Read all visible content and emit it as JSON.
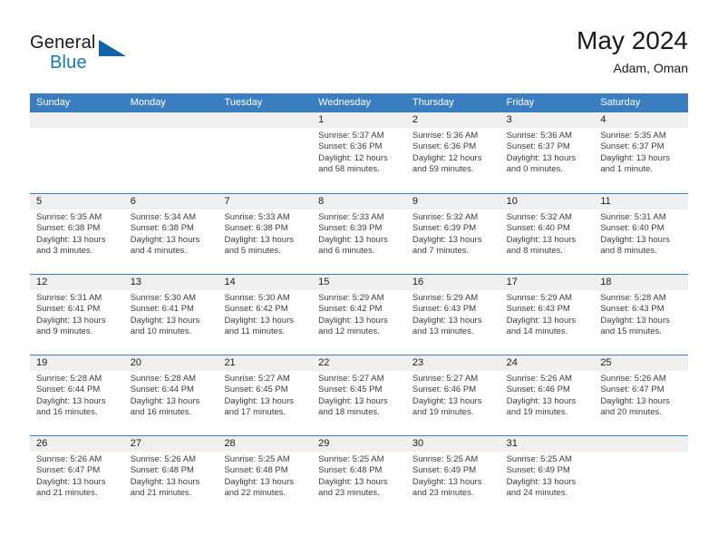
{
  "brand": {
    "word1": "General",
    "word2": "Blue",
    "triangle_color": "#1163a8",
    "blue_color": "#1675c0"
  },
  "header": {
    "month_title": "May 2024",
    "location": "Adam, Oman"
  },
  "theme": {
    "header_band": "#3a7ebf",
    "daynum_band": "#f0f0f0",
    "text": "#3c3c3c"
  },
  "calendar": {
    "day_headers": [
      "Sunday",
      "Monday",
      "Tuesday",
      "Wednesday",
      "Thursday",
      "Friday",
      "Saturday"
    ],
    "weeks": [
      [
        {
          "day": "",
          "lines": []
        },
        {
          "day": "",
          "lines": []
        },
        {
          "day": "",
          "lines": []
        },
        {
          "day": "1",
          "lines": [
            "Sunrise: 5:37 AM",
            "Sunset: 6:36 PM",
            "Daylight: 12 hours",
            "and 58 minutes."
          ]
        },
        {
          "day": "2",
          "lines": [
            "Sunrise: 5:36 AM",
            "Sunset: 6:36 PM",
            "Daylight: 12 hours",
            "and 59 minutes."
          ]
        },
        {
          "day": "3",
          "lines": [
            "Sunrise: 5:36 AM",
            "Sunset: 6:37 PM",
            "Daylight: 13 hours",
            "and 0 minutes."
          ]
        },
        {
          "day": "4",
          "lines": [
            "Sunrise: 5:35 AM",
            "Sunset: 6:37 PM",
            "Daylight: 13 hours",
            "and 1 minute."
          ]
        }
      ],
      [
        {
          "day": "5",
          "lines": [
            "Sunrise: 5:35 AM",
            "Sunset: 6:38 PM",
            "Daylight: 13 hours",
            "and 3 minutes."
          ]
        },
        {
          "day": "6",
          "lines": [
            "Sunrise: 5:34 AM",
            "Sunset: 6:38 PM",
            "Daylight: 13 hours",
            "and 4 minutes."
          ]
        },
        {
          "day": "7",
          "lines": [
            "Sunrise: 5:33 AM",
            "Sunset: 6:38 PM",
            "Daylight: 13 hours",
            "and 5 minutes."
          ]
        },
        {
          "day": "8",
          "lines": [
            "Sunrise: 5:33 AM",
            "Sunset: 6:39 PM",
            "Daylight: 13 hours",
            "and 6 minutes."
          ]
        },
        {
          "day": "9",
          "lines": [
            "Sunrise: 5:32 AM",
            "Sunset: 6:39 PM",
            "Daylight: 13 hours",
            "and 7 minutes."
          ]
        },
        {
          "day": "10",
          "lines": [
            "Sunrise: 5:32 AM",
            "Sunset: 6:40 PM",
            "Daylight: 13 hours",
            "and 8 minutes."
          ]
        },
        {
          "day": "11",
          "lines": [
            "Sunrise: 5:31 AM",
            "Sunset: 6:40 PM",
            "Daylight: 13 hours",
            "and 8 minutes."
          ]
        }
      ],
      [
        {
          "day": "12",
          "lines": [
            "Sunrise: 5:31 AM",
            "Sunset: 6:41 PM",
            "Daylight: 13 hours",
            "and 9 minutes."
          ]
        },
        {
          "day": "13",
          "lines": [
            "Sunrise: 5:30 AM",
            "Sunset: 6:41 PM",
            "Daylight: 13 hours",
            "and 10 minutes."
          ]
        },
        {
          "day": "14",
          "lines": [
            "Sunrise: 5:30 AM",
            "Sunset: 6:42 PM",
            "Daylight: 13 hours",
            "and 11 minutes."
          ]
        },
        {
          "day": "15",
          "lines": [
            "Sunrise: 5:29 AM",
            "Sunset: 6:42 PM",
            "Daylight: 13 hours",
            "and 12 minutes."
          ]
        },
        {
          "day": "16",
          "lines": [
            "Sunrise: 5:29 AM",
            "Sunset: 6:43 PM",
            "Daylight: 13 hours",
            "and 13 minutes."
          ]
        },
        {
          "day": "17",
          "lines": [
            "Sunrise: 5:29 AM",
            "Sunset: 6:43 PM",
            "Daylight: 13 hours",
            "and 14 minutes."
          ]
        },
        {
          "day": "18",
          "lines": [
            "Sunrise: 5:28 AM",
            "Sunset: 6:43 PM",
            "Daylight: 13 hours",
            "and 15 minutes."
          ]
        }
      ],
      [
        {
          "day": "19",
          "lines": [
            "Sunrise: 5:28 AM",
            "Sunset: 6:44 PM",
            "Daylight: 13 hours",
            "and 16 minutes."
          ]
        },
        {
          "day": "20",
          "lines": [
            "Sunrise: 5:28 AM",
            "Sunset: 6:44 PM",
            "Daylight: 13 hours",
            "and 16 minutes."
          ]
        },
        {
          "day": "21",
          "lines": [
            "Sunrise: 5:27 AM",
            "Sunset: 6:45 PM",
            "Daylight: 13 hours",
            "and 17 minutes."
          ]
        },
        {
          "day": "22",
          "lines": [
            "Sunrise: 5:27 AM",
            "Sunset: 6:45 PM",
            "Daylight: 13 hours",
            "and 18 minutes."
          ]
        },
        {
          "day": "23",
          "lines": [
            "Sunrise: 5:27 AM",
            "Sunset: 6:46 PM",
            "Daylight: 13 hours",
            "and 19 minutes."
          ]
        },
        {
          "day": "24",
          "lines": [
            "Sunrise: 5:26 AM",
            "Sunset: 6:46 PM",
            "Daylight: 13 hours",
            "and 19 minutes."
          ]
        },
        {
          "day": "25",
          "lines": [
            "Sunrise: 5:26 AM",
            "Sunset: 6:47 PM",
            "Daylight: 13 hours",
            "and 20 minutes."
          ]
        }
      ],
      [
        {
          "day": "26",
          "lines": [
            "Sunrise: 5:26 AM",
            "Sunset: 6:47 PM",
            "Daylight: 13 hours",
            "and 21 minutes."
          ]
        },
        {
          "day": "27",
          "lines": [
            "Sunrise: 5:26 AM",
            "Sunset: 6:48 PM",
            "Daylight: 13 hours",
            "and 21 minutes."
          ]
        },
        {
          "day": "28",
          "lines": [
            "Sunrise: 5:25 AM",
            "Sunset: 6:48 PM",
            "Daylight: 13 hours",
            "and 22 minutes."
          ]
        },
        {
          "day": "29",
          "lines": [
            "Sunrise: 5:25 AM",
            "Sunset: 6:48 PM",
            "Daylight: 13 hours",
            "and 23 minutes."
          ]
        },
        {
          "day": "30",
          "lines": [
            "Sunrise: 5:25 AM",
            "Sunset: 6:49 PM",
            "Daylight: 13 hours",
            "and 23 minutes."
          ]
        },
        {
          "day": "31",
          "lines": [
            "Sunrise: 5:25 AM",
            "Sunset: 6:49 PM",
            "Daylight: 13 hours",
            "and 24 minutes."
          ]
        },
        {
          "day": "",
          "lines": []
        }
      ]
    ]
  }
}
